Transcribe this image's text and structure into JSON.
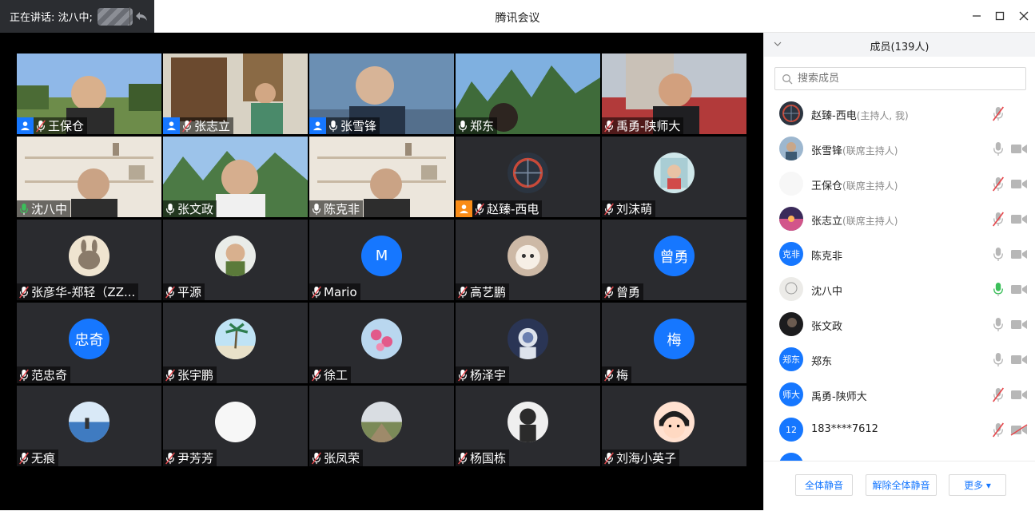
{
  "titlebar": {
    "speaking_label": "正在讲话: 沈八中;",
    "app_title": "腾讯会议"
  },
  "tiles": [
    {
      "name": "王保仓",
      "host": "blue",
      "mic": "muted",
      "scene": "video-outdoor"
    },
    {
      "name": "张志立",
      "host": "blue",
      "mic": "muted",
      "scene": "video-office"
    },
    {
      "name": "张雪锋",
      "host": "blue",
      "mic": "on",
      "scene": "video-sky"
    },
    {
      "name": "郑东",
      "host": "",
      "mic": "on",
      "scene": "video-karst"
    },
    {
      "name": "禹勇-陕师大",
      "host": "",
      "mic": "muted",
      "scene": "video-red"
    },
    {
      "name": "沈八中",
      "host": "",
      "mic": "speaking",
      "scene": "video-shelf",
      "speaking": true
    },
    {
      "name": "张文政",
      "host": "",
      "mic": "on",
      "scene": "video-karst2"
    },
    {
      "name": "陈克非",
      "host": "",
      "mic": "on",
      "scene": "video-shelf"
    },
    {
      "name": "赵臻-西电",
      "host": "orange",
      "mic": "muted",
      "avatar": "img-ferris"
    },
    {
      "name": "刘沫萌",
      "host": "",
      "mic": "muted",
      "avatar": "img-kid"
    },
    {
      "name": "张彦华-郑轻（ZZ...",
      "host": "",
      "mic": "muted",
      "avatar": "img-rabbit"
    },
    {
      "name": "平源",
      "host": "",
      "mic": "muted",
      "avatar": "img-child"
    },
    {
      "name": "Mario",
      "host": "",
      "mic": "muted",
      "avatar_text": "M"
    },
    {
      "name": "高艺鹏",
      "host": "",
      "mic": "muted",
      "avatar": "img-cat"
    },
    {
      "name": "曾勇",
      "host": "",
      "mic": "muted",
      "avatar_text": "曾勇"
    },
    {
      "name": "范忠奇",
      "host": "",
      "mic": "muted",
      "avatar_text": "忠奇"
    },
    {
      "name": "张宇鹏",
      "host": "",
      "mic": "muted",
      "avatar": "img-palm"
    },
    {
      "name": "徐工",
      "host": "",
      "mic": "muted",
      "avatar": "img-flower"
    },
    {
      "name": "杨泽宇",
      "host": "",
      "mic": "muted",
      "avatar": "img-astronaut"
    },
    {
      "name": "梅",
      "host": "",
      "mic": "muted",
      "avatar_text": "梅"
    },
    {
      "name": "无痕",
      "host": "",
      "mic": "muted",
      "avatar": "img-sea"
    },
    {
      "name": "尹芳芳",
      "host": "",
      "mic": "muted",
      "avatar": "img-white"
    },
    {
      "name": "张凤荣",
      "host": "",
      "mic": "muted",
      "avatar": "img-field"
    },
    {
      "name": "杨国栋",
      "host": "",
      "mic": "muted",
      "avatar": "img-person"
    },
    {
      "name": "刘海小英子",
      "host": "",
      "mic": "muted",
      "avatar": "img-cartoon"
    }
  ],
  "panel": {
    "title": "成员(139人)",
    "search_placeholder": "搜索成员",
    "members": [
      {
        "name": "赵臻-西电",
        "role": "(主持人, 我)",
        "mic": "muted-red",
        "cam": "none",
        "avatar": "img-ferris"
      },
      {
        "name": "张雪锋",
        "role": "(联席主持人)",
        "mic": "on",
        "cam": "on",
        "avatar": "img-sky"
      },
      {
        "name": "王保仓",
        "role": "(联席主持人)",
        "mic": "muted-red",
        "cam": "on",
        "avatar": "img-white"
      },
      {
        "name": "张志立",
        "role": "(联席主持人)",
        "mic": "muted-red",
        "cam": "on",
        "avatar": "img-sunset"
      },
      {
        "name": "陈克非",
        "role": "",
        "mic": "on",
        "cam": "on",
        "avatar_text": "克非"
      },
      {
        "name": "沈八中",
        "role": "",
        "mic": "speaking",
        "cam": "on",
        "avatar": "img-sketch"
      },
      {
        "name": "张文政",
        "role": "",
        "mic": "on",
        "cam": "on",
        "avatar": "img-dark"
      },
      {
        "name": "郑东",
        "role": "",
        "mic": "on",
        "cam": "on",
        "avatar_text": "郑东"
      },
      {
        "name": "禹勇-陕师大",
        "role": "",
        "mic": "muted-red",
        "cam": "on",
        "avatar_text": "师大"
      },
      {
        "name": "183****7612",
        "role": "",
        "mic": "muted-red",
        "cam": "off",
        "avatar_text": "12"
      }
    ],
    "footer": {
      "mute_all": "全体静音",
      "unmute_all": "解除全体静音",
      "more": "更多 ▾"
    }
  },
  "colors": {
    "accent": "#1677ff",
    "speaking_green": "#3bbf5a",
    "muted_red": "#e5484d",
    "tile_bg": "#2a2b2f"
  }
}
